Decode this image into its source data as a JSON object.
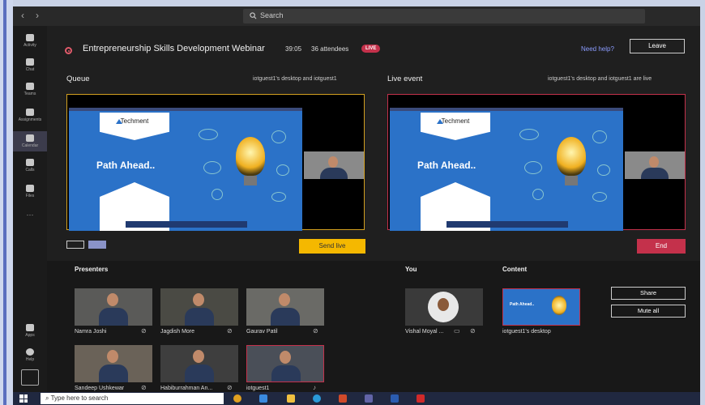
{
  "titlebar": {
    "search_placeholder": "Search",
    "back": "‹",
    "forward": "›"
  },
  "rail": {
    "items": [
      {
        "label": "Activity"
      },
      {
        "label": "Chat"
      },
      {
        "label": "Teams"
      },
      {
        "label": "Assignments"
      },
      {
        "label": "Calendar",
        "active": true
      },
      {
        "label": "Calls"
      },
      {
        "label": "Files"
      },
      {
        "label": "···"
      }
    ],
    "apps": "Apps",
    "help": "Help"
  },
  "meeting": {
    "title": "Entrepreneurship Skills Development Webinar",
    "elapsed": "39:05",
    "attendees": "36 attendees",
    "live_badge": "LIVE",
    "help": "Need help?",
    "leave": "Leave"
  },
  "queue": {
    "title": "Queue",
    "subtitle": "iotguest1's desktop and iotguest1",
    "send_live": "Send live"
  },
  "live_event": {
    "title": "Live event",
    "subtitle": "iotguest1's desktop and iotguest1 are live",
    "end": "End"
  },
  "slide": {
    "brand": "Techment",
    "heading": "Path Ahead.."
  },
  "presenters": {
    "label": "Presenters",
    "people": [
      {
        "name": "Namra Joshi"
      },
      {
        "name": "Jagdish More"
      },
      {
        "name": "Gaurav Patil"
      },
      {
        "name": "Sandeep Ushkewar"
      },
      {
        "name": "Habiburrahman An..."
      },
      {
        "name": "iotguest1"
      }
    ]
  },
  "you": {
    "label": "You",
    "name": "Vishal Moyal ..."
  },
  "content": {
    "label": "Content",
    "name": "iotguest1's desktop",
    "thumb_text": "Path Ahead.."
  },
  "actions": {
    "share": "Share",
    "mute_all": "Mute all"
  },
  "taskbar": {
    "search_placeholder": "Type here to search"
  },
  "colors": {
    "live_red": "#c4314b",
    "queue_gold": "#d2a020",
    "send_live": "#f5b800",
    "link": "#8b9cff"
  }
}
